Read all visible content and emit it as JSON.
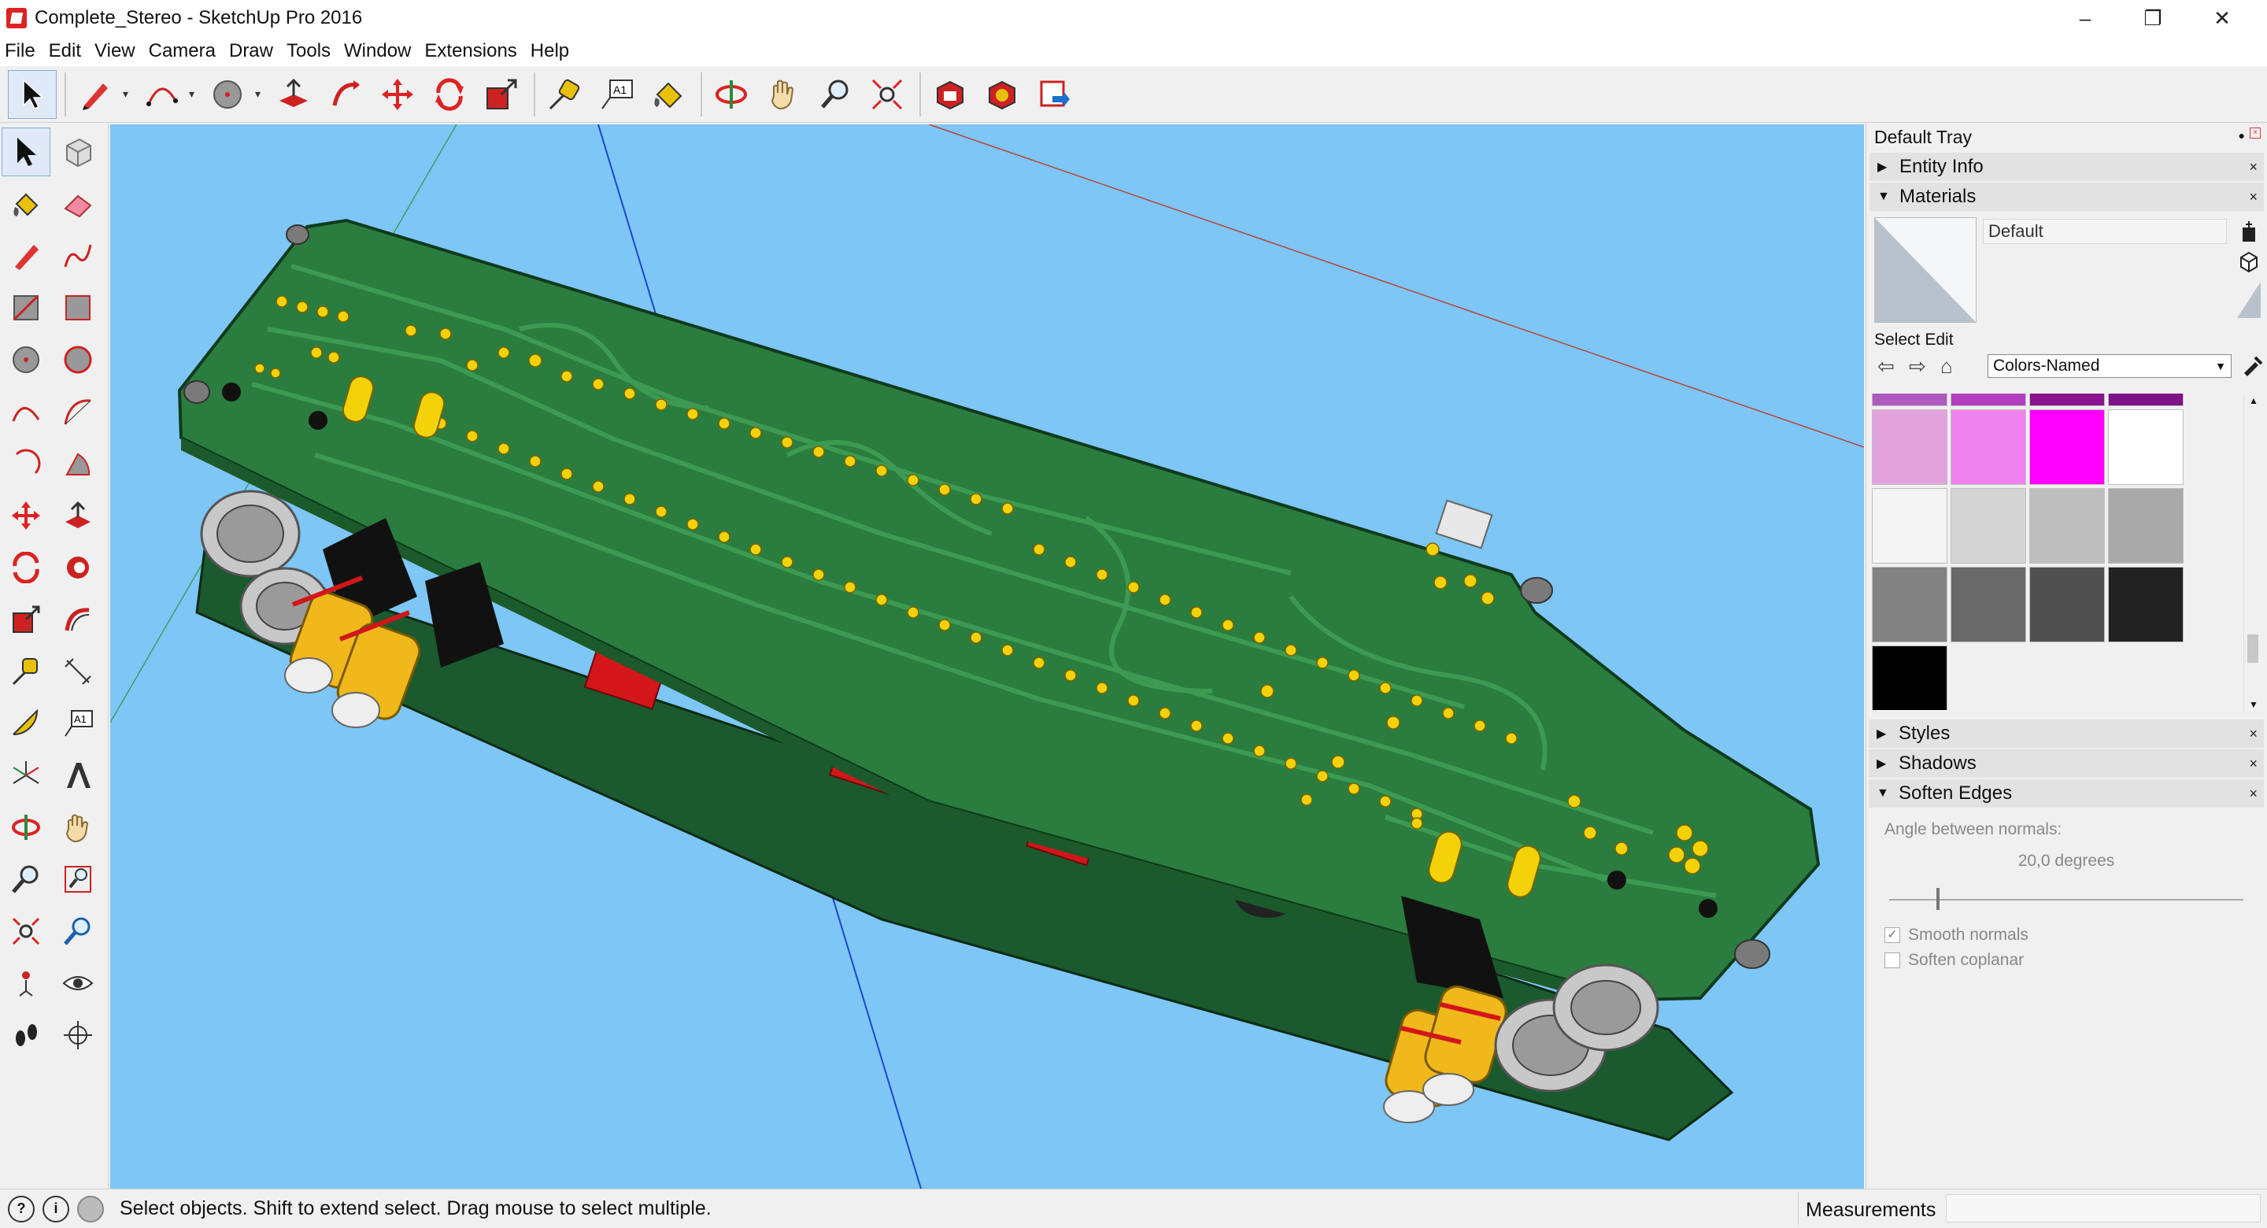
{
  "window": {
    "title": "Complete_Stereo - SketchUp Pro 2016"
  },
  "menu": [
    "File",
    "Edit",
    "View",
    "Camera",
    "Draw",
    "Tools",
    "Window",
    "Extensions",
    "Help"
  ],
  "tray": {
    "title": "Default Tray",
    "panels": {
      "entity_info": "Entity Info",
      "materials": "Materials",
      "styles": "Styles",
      "shadows": "Shadows",
      "soften_edges": "Soften Edges"
    },
    "materials": {
      "name": "Default",
      "tab_select": "Select",
      "tab_edit": "Edit",
      "collection": "Colors-Named",
      "swatches": [
        "#b05abf",
        "#b43ec0",
        "#8a138e",
        "#7e1287",
        "#e2a2dc",
        "#ef82ee",
        "#ff00ff",
        "#ffffff",
        "#f4f4f4",
        "#d4d4d4",
        "#bebebe",
        "#a9a9a9",
        "#828282",
        "#696969",
        "#505050",
        "#222222",
        "#000000"
      ]
    },
    "soften": {
      "label": "Angle between normals:",
      "value": "20,0  degrees",
      "smooth": "Smooth normals",
      "coplanar": "Soften coplanar"
    }
  },
  "status": {
    "message": "Select objects. Shift to extend select. Drag mouse to select multiple.",
    "measurements_label": "Measurements"
  },
  "colors": {
    "viewport_bg": "#7dc6f5",
    "pcb_green": "#2a7d3e",
    "pad_yellow": "#f4d20a",
    "connector_red": "#d2161a"
  }
}
